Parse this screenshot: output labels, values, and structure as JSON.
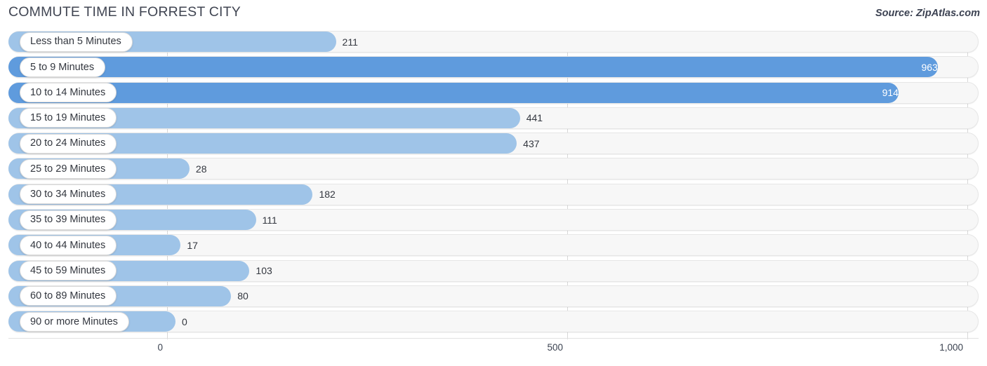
{
  "header": {
    "title": "COMMUTE TIME IN FORREST CITY",
    "source": "Source: ZipAtlas.com"
  },
  "colors": {
    "bar_light": "#9fc4e8",
    "bar_dark": "#5f9bdd",
    "track_bg": "#f7f7f7",
    "gridline": "#d8d8d8",
    "text": "#33373f"
  },
  "chart_data": {
    "type": "bar",
    "orientation": "horizontal",
    "title": "COMMUTE TIME IN FORREST CITY",
    "xlabel": "",
    "ylabel": "",
    "xlim": [
      0,
      1000
    ],
    "grid": true,
    "legend": "none",
    "source": "Source: ZipAtlas.com",
    "tick_labels": [
      "0",
      "500",
      "1,000"
    ],
    "tick_values": [
      0,
      500,
      1000
    ],
    "categories": [
      "Less than 5 Minutes",
      "5 to 9 Minutes",
      "10 to 14 Minutes",
      "15 to 19 Minutes",
      "20 to 24 Minutes",
      "25 to 29 Minutes",
      "30 to 34 Minutes",
      "35 to 39 Minutes",
      "40 to 44 Minutes",
      "45 to 59 Minutes",
      "60 to 89 Minutes",
      "90 or more Minutes"
    ],
    "values": [
      211,
      963,
      914,
      441,
      437,
      28,
      182,
      111,
      17,
      103,
      80,
      0
    ],
    "value_labels": [
      "211",
      "963",
      "914",
      "441",
      "437",
      "28",
      "182",
      "111",
      "17",
      "103",
      "80",
      "0"
    ]
  },
  "rows": [
    {
      "label": "Less than 5 Minutes",
      "value": 211,
      "value_label": "211",
      "inside": false,
      "shade": "light"
    },
    {
      "label": "5 to 9 Minutes",
      "value": 963,
      "value_label": "963",
      "inside": true,
      "shade": "dark"
    },
    {
      "label": "10 to 14 Minutes",
      "value": 914,
      "value_label": "914",
      "inside": true,
      "shade": "dark"
    },
    {
      "label": "15 to 19 Minutes",
      "value": 441,
      "value_label": "441",
      "inside": false,
      "shade": "light"
    },
    {
      "label": "20 to 24 Minutes",
      "value": 437,
      "value_label": "437",
      "inside": false,
      "shade": "light"
    },
    {
      "label": "25 to 29 Minutes",
      "value": 28,
      "value_label": "28",
      "inside": false,
      "shade": "light"
    },
    {
      "label": "30 to 34 Minutes",
      "value": 182,
      "value_label": "182",
      "inside": false,
      "shade": "light"
    },
    {
      "label": "35 to 39 Minutes",
      "value": 111,
      "value_label": "111",
      "inside": false,
      "shade": "light"
    },
    {
      "label": "40 to 44 Minutes",
      "value": 17,
      "value_label": "17",
      "inside": false,
      "shade": "light"
    },
    {
      "label": "45 to 59 Minutes",
      "value": 103,
      "value_label": "103",
      "inside": false,
      "shade": "light"
    },
    {
      "label": "60 to 89 Minutes",
      "value": 80,
      "value_label": "80",
      "inside": false,
      "shade": "light"
    },
    {
      "label": "90 or more Minutes",
      "value": 0,
      "value_label": "0",
      "inside": false,
      "shade": "light"
    }
  ]
}
